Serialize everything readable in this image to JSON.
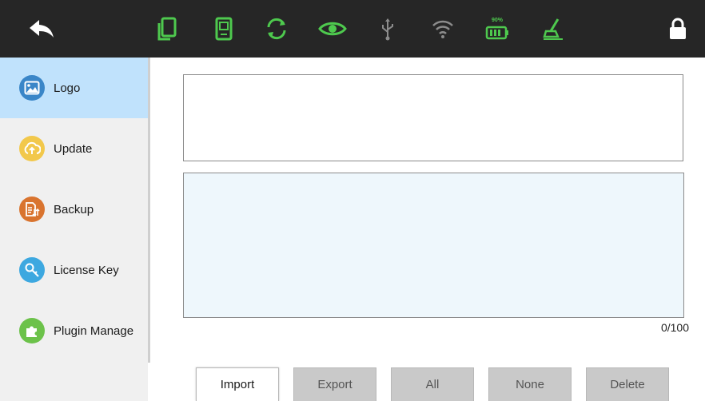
{
  "topbar": {
    "icons": [
      {
        "name": "back-arrow-icon",
        "color": "#ffffff"
      },
      {
        "name": "copy-device-icon",
        "color": "#4ec94e"
      },
      {
        "name": "tablet-icon",
        "color": "#4ec94e"
      },
      {
        "name": "sync-icon",
        "color": "#4ec94e"
      },
      {
        "name": "eye-icon",
        "color": "#4ec94e"
      },
      {
        "name": "usb-icon",
        "color": "#8c8c8c"
      },
      {
        "name": "wifi-icon",
        "color": "#8c8c8c"
      },
      {
        "name": "battery-icon",
        "color": "#4ec94e"
      },
      {
        "name": "clean-brush-icon",
        "color": "#4ec94e"
      },
      {
        "name": "lock-icon",
        "color": "#ffffff"
      }
    ],
    "battery_label": "90%"
  },
  "sidebar": {
    "items": [
      {
        "label": "Logo",
        "icon": "image-icon",
        "color": "#3a86c8",
        "active": true
      },
      {
        "label": "Update",
        "icon": "cloud-upload-icon",
        "color": "#f2c84b",
        "active": false
      },
      {
        "label": "Backup",
        "icon": "document-transfer-icon",
        "color": "#d9742f",
        "active": false
      },
      {
        "label": "License Key",
        "icon": "key-icon",
        "color": "#3da8e0",
        "active": false
      },
      {
        "label": "Plugin Manage",
        "icon": "puzzle-icon",
        "color": "#6cc24a",
        "active": false
      }
    ]
  },
  "main": {
    "top_field_value": "",
    "list_value": "",
    "counter": "0/100"
  },
  "actions": {
    "import": "Import",
    "export": "Export",
    "all": "All",
    "none": "None",
    "delete": "Delete"
  },
  "colors": {
    "topbar": "#262626",
    "accent_green": "#4ec94e",
    "sidebar_active": "#c0e2fc",
    "list_bg": "#eef7fc",
    "button_disabled": "#c9c9c9"
  }
}
